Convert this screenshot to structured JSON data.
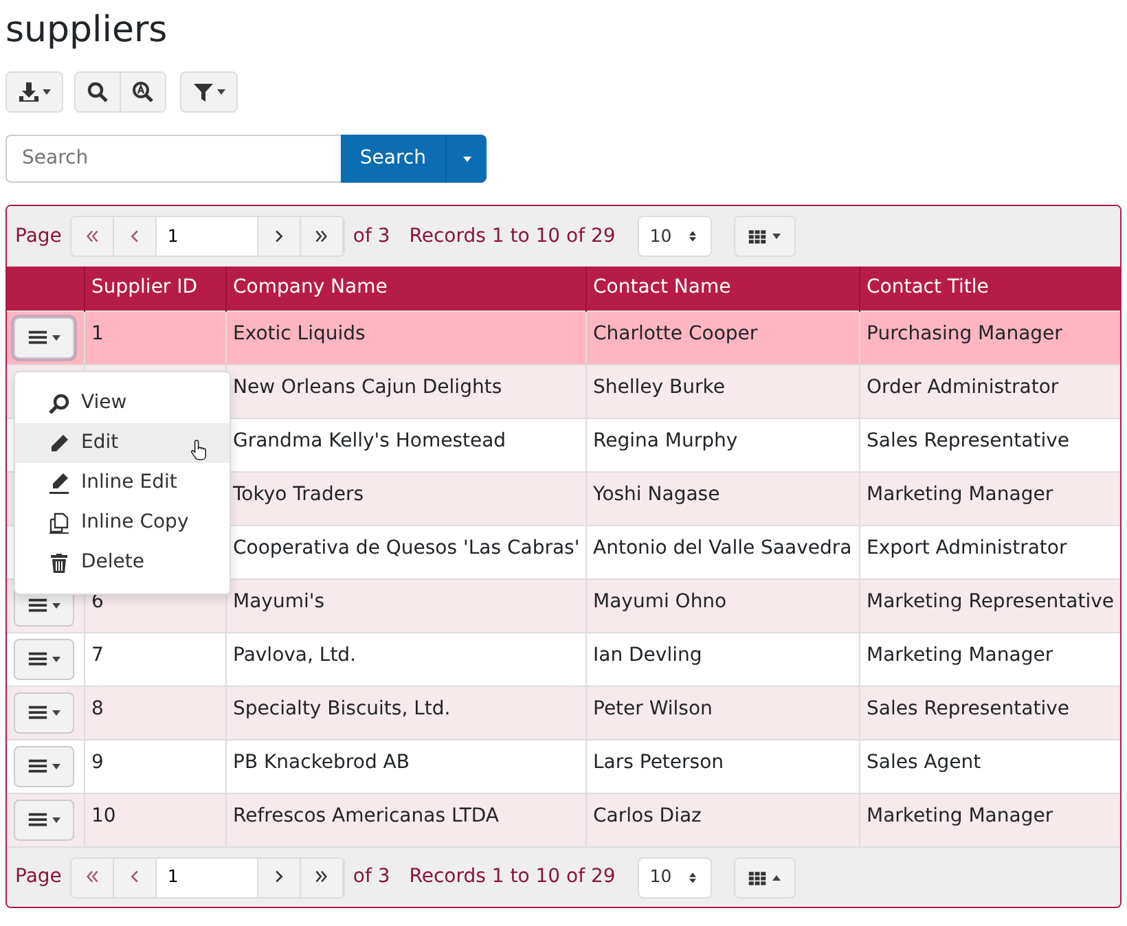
{
  "title": "suppliers",
  "search": {
    "placeholder": "Search",
    "button": "Search"
  },
  "pagers": [
    {
      "kind": "dropdown",
      "page_label": "Page",
      "page": "1",
      "of": "of 3",
      "records": "Records 1 to 10 of 29",
      "page_size": "10"
    },
    {
      "kind": "dropup",
      "page_label": "Page",
      "page": "1",
      "of": "of 3",
      "records": "Records 1 to 10 of 29",
      "page_size": "10"
    }
  ],
  "table": {
    "columns": [
      "Supplier ID",
      "Company Name",
      "Contact Name",
      "Contact Title"
    ],
    "rows": [
      {
        "id": "1",
        "company": "Exotic Liquids",
        "contact": "Charlotte Cooper",
        "title": "Purchasing Manager",
        "selected": true,
        "menu_open": true
      },
      {
        "company": "New Orleans Cajun Delights",
        "contact": "Shelley Burke",
        "title": "Order Administrator",
        "selected": false,
        "menu_open": false
      },
      {
        "company": "Grandma Kelly's Homestead",
        "contact": "Regina Murphy",
        "title": "Sales Representative",
        "selected": false,
        "menu_open": false
      },
      {
        "company": "Tokyo Traders",
        "contact": "Yoshi Nagase",
        "title": "Marketing Manager",
        "selected": false,
        "menu_open": false
      },
      {
        "company": "Cooperativa de Quesos 'Las Cabras'",
        "contact": "Antonio del Valle Saavedra",
        "title": "Export Administrator",
        "selected": false,
        "menu_open": false
      },
      {
        "id": "6",
        "company": "Mayumi's",
        "contact": "Mayumi Ohno",
        "title": "Marketing Representative",
        "selected": false,
        "menu_open": false
      },
      {
        "id": "7",
        "company": "Pavlova, Ltd.",
        "contact": "Ian Devling",
        "title": "Marketing Manager",
        "selected": false,
        "menu_open": false
      },
      {
        "id": "8",
        "company": "Specialty Biscuits, Ltd.",
        "contact": "Peter Wilson",
        "title": "Sales Representative",
        "selected": false,
        "menu_open": false
      },
      {
        "id": "9",
        "company": "PB Knackebrod AB",
        "contact": "Lars Peterson",
        "title": "Sales Agent",
        "selected": false,
        "menu_open": false
      },
      {
        "id": "10",
        "company": "Refrescos Americanas LTDA",
        "contact": "Carlos Diaz",
        "title": "Marketing Manager",
        "selected": false,
        "menu_open": false
      }
    ]
  },
  "row_menu": [
    {
      "kind": "view",
      "label": "View",
      "hovered": false
    },
    {
      "kind": "edit",
      "label": "Edit",
      "hovered": true
    },
    {
      "kind": "inline-edit",
      "label": "Inline Edit",
      "hovered": false
    },
    {
      "kind": "inline-copy",
      "label": "Inline Copy",
      "hovered": false
    },
    {
      "kind": "delete",
      "label": "Delete",
      "hovered": false
    }
  ]
}
